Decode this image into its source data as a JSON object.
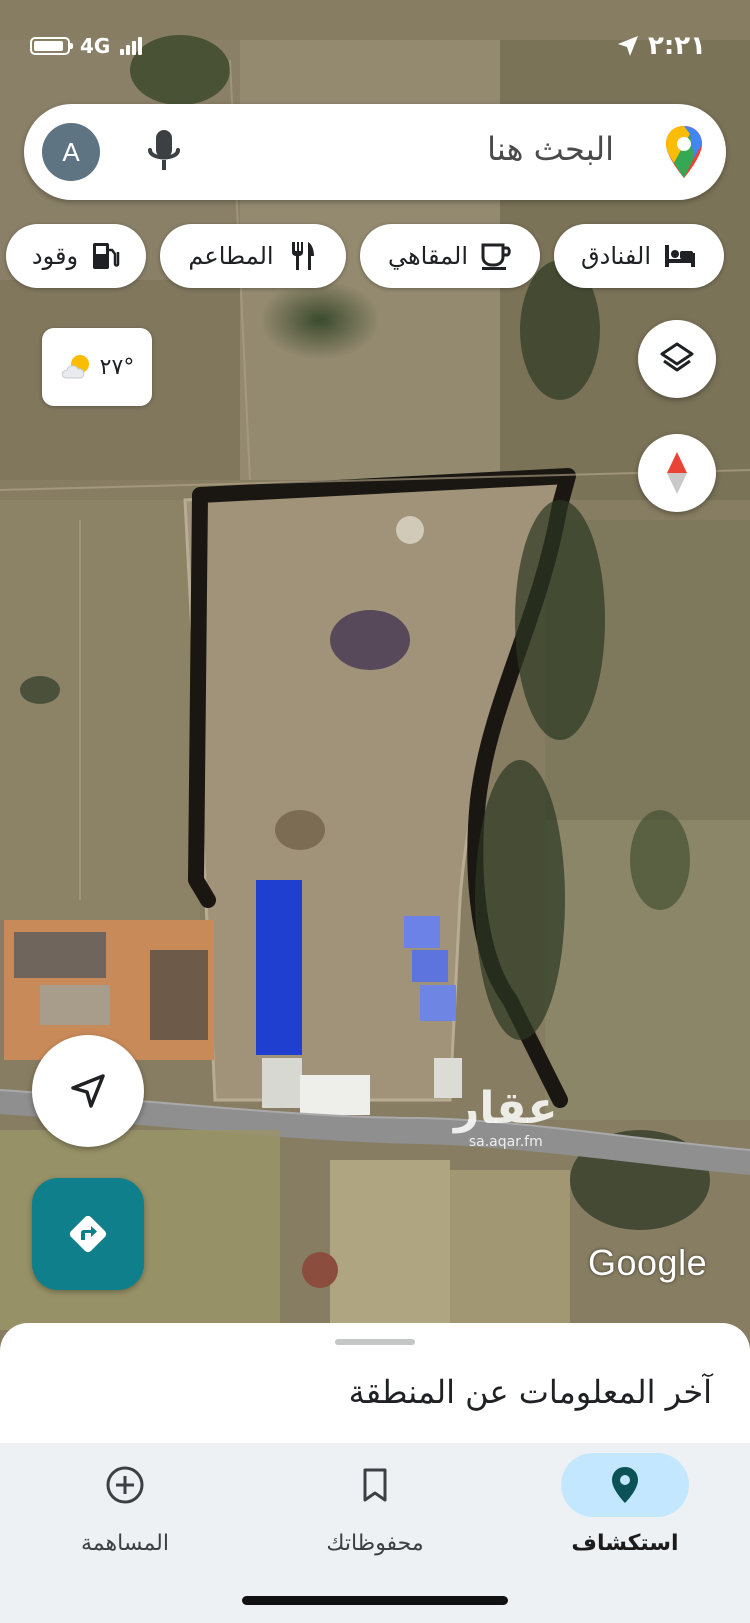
{
  "status_bar": {
    "network": "4G",
    "time": "٢:٢١"
  },
  "search": {
    "avatar_letter": "A",
    "placeholder": "البحث هنا"
  },
  "chips": [
    {
      "label": "الفنادق",
      "icon": "hotel-bed-icon"
    },
    {
      "label": "المقاهي",
      "icon": "coffee-cup-icon"
    },
    {
      "label": "المطاعم",
      "icon": "fork-knife-icon"
    },
    {
      "label": "وقود",
      "icon": "gas-station-icon"
    }
  ],
  "weather": {
    "temperature": "٢٧°",
    "icon": "partly-cloudy-icon"
  },
  "map": {
    "layers_icon": "layers-icon",
    "compass_icon": "compass-icon",
    "watermark": "عقار",
    "watermark_url": "sa.aqar.fm",
    "attribution": "Google"
  },
  "bottom_sheet": {
    "title": "آخر المعلومات عن المنطقة"
  },
  "nav": {
    "explore": "استكشاف",
    "saved": "محفوظاتك",
    "contribute": "المساهمة"
  },
  "colors": {
    "accent": "#0f7f8c",
    "nav_active_bg": "#c2e7ff",
    "nav_background": "#eef1f4"
  }
}
